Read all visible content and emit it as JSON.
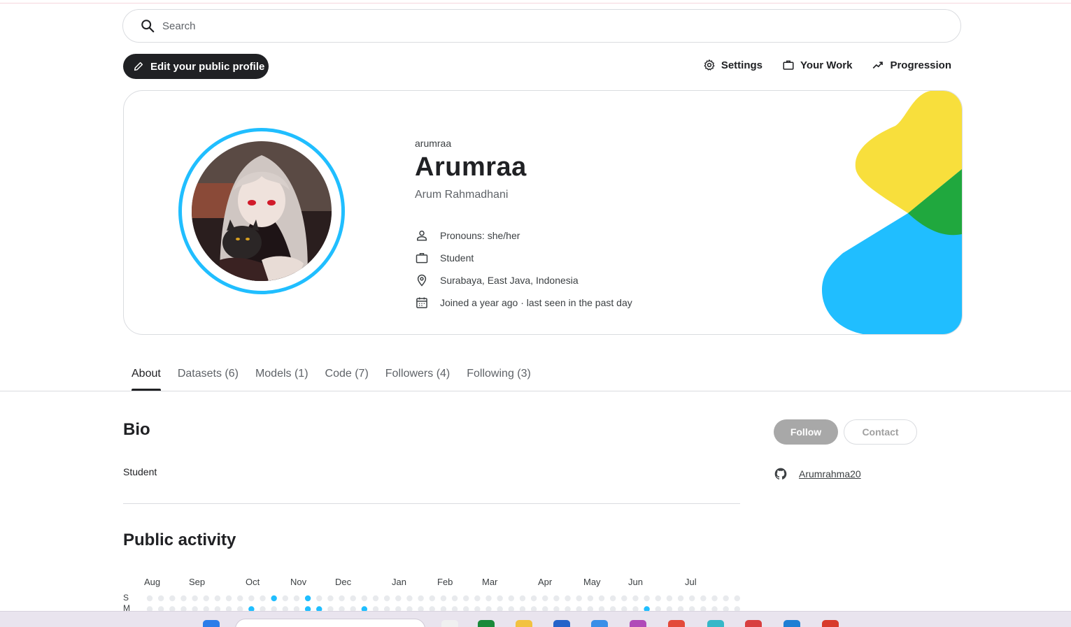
{
  "search": {
    "placeholder": "Search"
  },
  "toolbar": {
    "edit_label": "Edit your public profile",
    "links": [
      {
        "label": "Settings",
        "icon": "gear-icon"
      },
      {
        "label": "Your Work",
        "icon": "briefcase-icon"
      },
      {
        "label": "Progression",
        "icon": "trending-up-icon"
      }
    ]
  },
  "profile": {
    "username": "arumraa",
    "display_name": "Arumraa",
    "full_name": "Arum Rahmadhani",
    "details": [
      {
        "icon": "person-icon",
        "text": "Pronouns: she/her"
      },
      {
        "icon": "briefcase-icon",
        "text": "Student"
      },
      {
        "icon": "location-pin-icon",
        "text": "Surabaya, East Java, Indonesia"
      },
      {
        "icon": "calendar-icon",
        "text": "Joined a year ago · last seen in the past day"
      }
    ],
    "accent": "#20beff"
  },
  "tabs": [
    {
      "label": "About",
      "active": true
    },
    {
      "label": "Datasets (6)"
    },
    {
      "label": "Models (1)"
    },
    {
      "label": "Code (7)"
    },
    {
      "label": "Followers (4)"
    },
    {
      "label": "Following (3)"
    }
  ],
  "bio": {
    "title": "Bio",
    "text": "Student"
  },
  "actions": {
    "follow_label": "Follow",
    "contact_label": "Contact"
  },
  "github": {
    "handle": "Arumrahma20"
  },
  "activity": {
    "title": "Public activity",
    "months": [
      "Aug",
      "Sep",
      "Oct",
      "Nov",
      "Dec",
      "Jan",
      "Feb",
      "Mar",
      "Apr",
      "May",
      "Jun",
      "Jul"
    ],
    "day_labels": [
      "S",
      "M"
    ],
    "active_color": "#20beff",
    "inactive_color": "#e8eaed"
  }
}
